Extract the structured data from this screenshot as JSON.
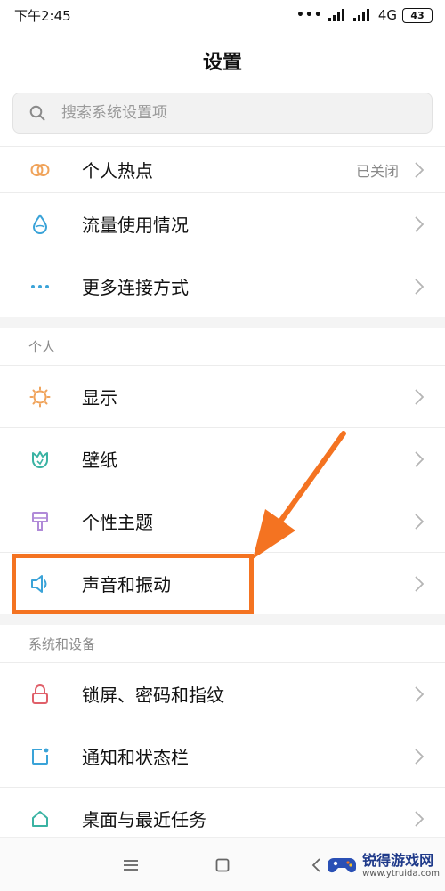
{
  "status_bar": {
    "time": "下午2:45",
    "dots": "•••",
    "network": "4G",
    "battery": "43"
  },
  "header": {
    "title": "设置"
  },
  "search": {
    "placeholder": "搜索系统设置项"
  },
  "connection_items": [
    {
      "label": "个人热点",
      "value": "已关闭",
      "icon": "hotspot-icon"
    },
    {
      "label": "流量使用情况",
      "value": "",
      "icon": "water-drop-icon"
    },
    {
      "label": "更多连接方式",
      "value": "",
      "icon": "more-dots-icon"
    }
  ],
  "personal": {
    "header": "个人",
    "items": [
      {
        "label": "显示",
        "icon": "brightness-icon"
      },
      {
        "label": "壁纸",
        "icon": "tulip-icon"
      },
      {
        "label": "个性主题",
        "icon": "brush-icon"
      },
      {
        "label": "声音和振动",
        "icon": "speaker-icon"
      }
    ]
  },
  "system": {
    "header": "系统和设备",
    "items": [
      {
        "label": "锁屏、密码和指纹",
        "icon": "lock-icon"
      },
      {
        "label": "通知和状态栏",
        "icon": "notification-icon"
      },
      {
        "label": "桌面与最近任务",
        "icon": "home-icon"
      }
    ]
  },
  "watermark": {
    "name": "锐得游戏网",
    "url": "www.ytruida.com"
  },
  "colors": {
    "highlight": "#f47321",
    "orange_icon": "#f0a35a",
    "blue_icon": "#3aa3d8",
    "teal_icon": "#3ab3a3",
    "purple_icon": "#b08ad8",
    "red_icon": "#e0606a"
  }
}
